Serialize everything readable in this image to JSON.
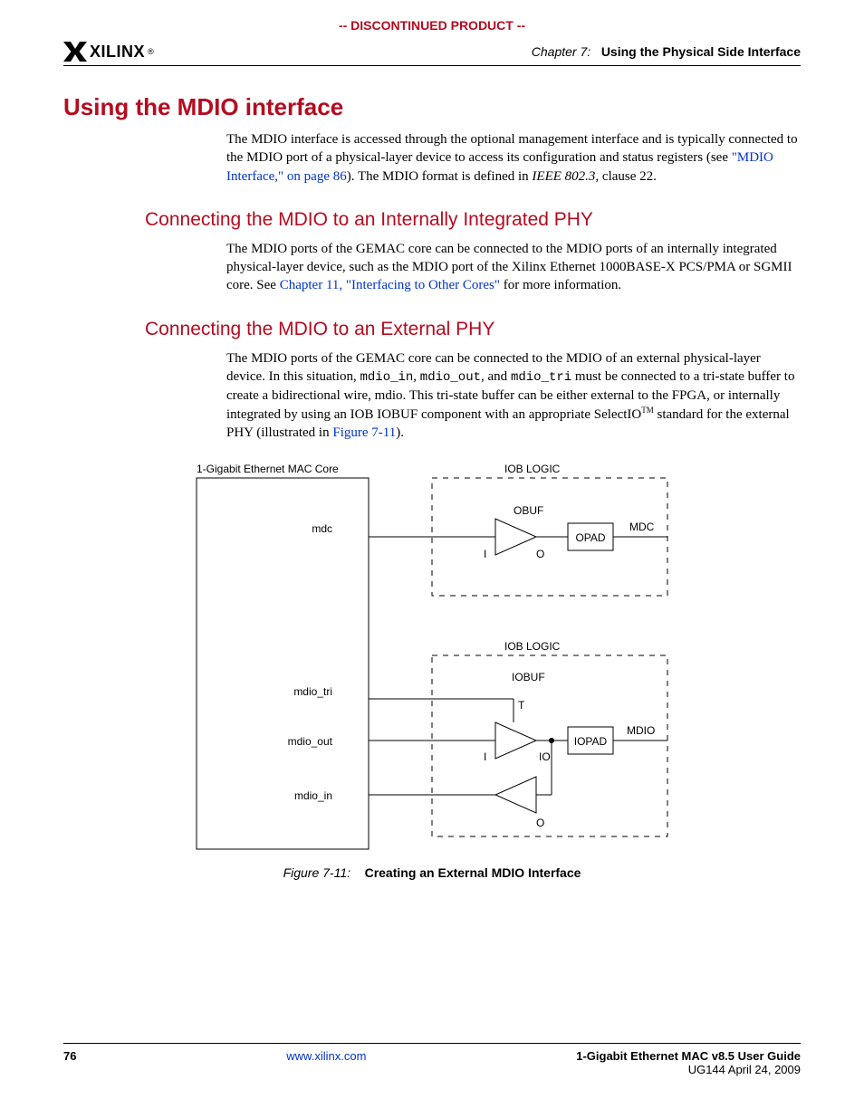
{
  "banner": "-- DISCONTINUED PRODUCT --",
  "logo": {
    "word": "XILINX",
    "reg": "®"
  },
  "header": {
    "chapter_label": "Chapter 7:",
    "chapter_title": "Using the Physical Side Interface"
  },
  "h1": "Using the MDIO interface",
  "para1": {
    "t1": "The MDIO interface is accessed through the optional management interface and is typically connected to the MDIO port of a physical-layer device to access its configuration and status registers (see ",
    "link": "\"MDIO Interface,\" on page 86",
    "t2": "). The MDIO format is defined in ",
    "ital": "IEEE 802.3,",
    "t3": " clause 22."
  },
  "h2a": "Connecting the MDIO to an Internally Integrated PHY",
  "para2": {
    "t1": "The MDIO ports of the GEMAC core can be connected to the MDIO ports of an internally integrated physical-layer device, such as the MDIO port of the Xilinx Ethernet 1000BASE-X PCS/PMA or SGMII core. See ",
    "link": "Chapter 11, \"Interfacing to Other Cores\"",
    "t2": " for more information."
  },
  "h2b": "Connecting the MDIO to an External PHY",
  "para3": {
    "t1": "The MDIO ports of the GEMAC core can be connected to the MDIO of an external physical-layer device. In this situation, ",
    "c1": "mdio_in",
    "t2": ", ",
    "c2": "mdio_out",
    "t3": ", and ",
    "c3": "mdio_tri",
    "t4": " must be connected to a tri-state buffer to create a bidirectional wire, mdio. This tri-state buffer can be either external to the FPGA, or internally integrated by using an IOB IOBUF component with an appropriate SelectIO",
    "tm": "TM",
    "t5": " standard for the external PHY (illustrated in ",
    "link": "Figure 7-11",
    "t6": ")."
  },
  "diagram": {
    "core_label": "1-Gigabit Ethernet MAC Core",
    "iob_logic": "IOB LOGIC",
    "obuf": "OBUF",
    "iobuf": "IOBUF",
    "opad": "OPAD",
    "iopad": "IOPAD",
    "mdc_sig": "mdc",
    "mdc_out": "MDC",
    "mdio_tri": "mdio_tri",
    "mdio_out_sig": "mdio_out",
    "mdio_in_sig": "mdio_in",
    "mdio_out": "MDIO",
    "I": "I",
    "O": "O",
    "T": "T",
    "IO": "IO"
  },
  "figcap": {
    "num": "Figure 7-11:",
    "title": "Creating an External MDIO Interface"
  },
  "footer": {
    "page": "76",
    "url": "www.xilinx.com",
    "guide": "1-Gigabit Ethernet MAC v8.5 User Guide",
    "docid": "UG144 April 24, 2009"
  }
}
